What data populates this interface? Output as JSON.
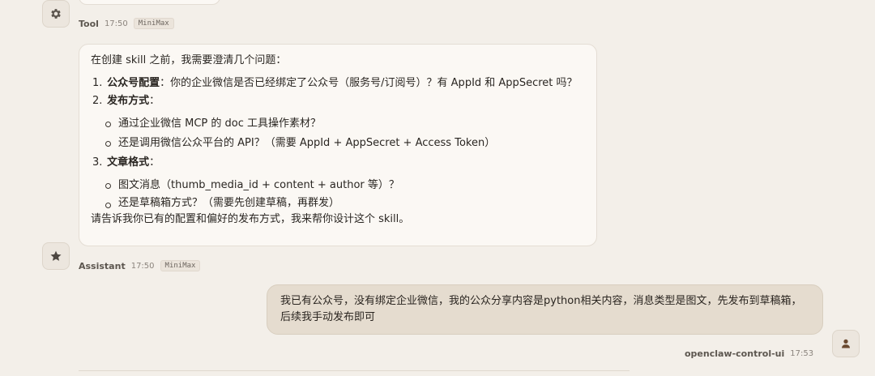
{
  "tool_message": {
    "sender": "Tool",
    "time": "17:50",
    "model": "MiniMax",
    "icon": "gear-icon"
  },
  "assistant_message": {
    "sender": "Assistant",
    "time": "17:50",
    "model": "MiniMax",
    "icon": "star-icon",
    "intro": "在创建 skill 之前，我需要澄清几个问题：",
    "items": [
      {
        "num": "1.",
        "title": "公众号配置",
        "text": "：你的企业微信是否已经绑定了公众号（服务号/订阅号）？有 AppId 和 AppSecret 吗？"
      },
      {
        "num": "2.",
        "title": "发布方式",
        "text": "：",
        "sub": [
          "通过企业微信 MCP 的 doc 工具操作素材？",
          "还是调用微信公众平台的 API？（需要 AppId + AppSecret + Access Token）"
        ]
      },
      {
        "num": "3.",
        "title": "文章格式",
        "text": "：",
        "sub": [
          "图文消息（thumb_media_id + content + author 等）？",
          "还是草稿箱方式？（需要先创建草稿，再群发）"
        ]
      }
    ],
    "outro": "请告诉我你已有的配置和偏好的发布方式，我来帮你设计这个 skill。"
  },
  "user_message": {
    "text": "我已有公众号，没有绑定企业微信，我的公众分享内容是python相关内容，消息类型是图文，先发布到草稿箱，后续我手动发布即可",
    "sender": "openclaw-control-ui",
    "time": "17:53",
    "icon": "user-icon"
  }
}
